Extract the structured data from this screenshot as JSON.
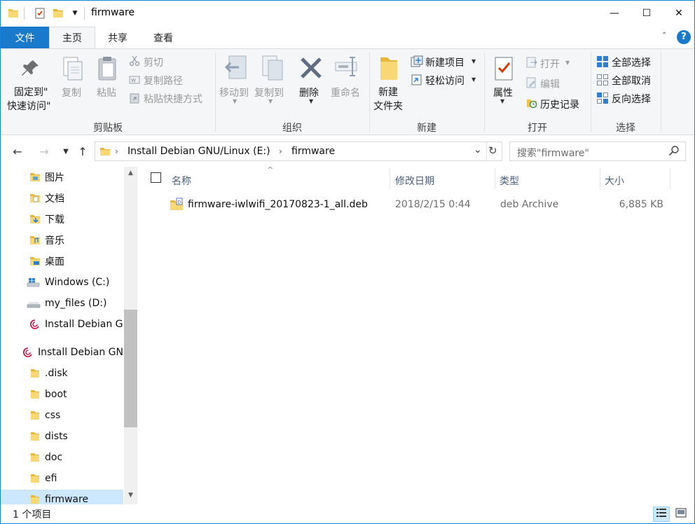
{
  "window": {
    "title": "firmware"
  },
  "title_buttons": {
    "minimize": "—",
    "maximize": "☐",
    "close": "✕"
  },
  "tabs": [
    {
      "label": "文件"
    },
    {
      "label": "主页"
    },
    {
      "label": "共享"
    },
    {
      "label": "查看"
    }
  ],
  "ribbon": {
    "clipboard": {
      "pin_line1": "固定到\"",
      "pin_line2": "快速访问\"",
      "copy": "复制",
      "paste": "粘贴",
      "cut": "剪切",
      "copy_path": "复制路径",
      "paste_shortcut": "粘贴快捷方式",
      "group": "剪贴板"
    },
    "organize": {
      "move_to": "移动到",
      "copy_to": "复制到",
      "delete": "删除",
      "rename": "重命名",
      "group": "组织"
    },
    "new": {
      "new_folder_line1": "新建",
      "new_folder_line2": "文件夹",
      "new_item": "新建项目",
      "easy_access": "轻松访问",
      "group": "新建"
    },
    "open": {
      "properties": "属性",
      "open": "打开",
      "edit": "编辑",
      "history": "历史记录",
      "group": "打开"
    },
    "select": {
      "select_all": "全部选择",
      "select_none": "全部取消",
      "invert": "反向选择",
      "group": "选择"
    }
  },
  "address": {
    "crumbs": [
      "Install Debian GNU/Linux (E:)",
      "firmware"
    ],
    "search_placeholder": "搜索\"firmware\""
  },
  "navpane": {
    "items": [
      {
        "label": "图片",
        "icon": "pictures-folder-icon"
      },
      {
        "label": "文档",
        "icon": "documents-folder-icon"
      },
      {
        "label": "下载",
        "icon": "downloads-folder-icon"
      },
      {
        "label": "音乐",
        "icon": "music-folder-icon"
      },
      {
        "label": "桌面",
        "icon": "desktop-folder-icon"
      },
      {
        "label": "Windows (C:)",
        "icon": "windows-drive-icon"
      },
      {
        "label": "my_files (D:)",
        "icon": "drive-icon"
      },
      {
        "label": "Install Debian GNU/Linux (E:)",
        "icon": "debian-icon"
      },
      {
        "label": "Install Debian GNU/Linux (E:)",
        "icon": "debian-icon"
      },
      {
        "label": ".disk",
        "icon": "folder-icon"
      },
      {
        "label": "boot",
        "icon": "folder-icon"
      },
      {
        "label": "css",
        "icon": "folder-icon"
      },
      {
        "label": "dists",
        "icon": "folder-icon"
      },
      {
        "label": "doc",
        "icon": "folder-icon"
      },
      {
        "label": "efi",
        "icon": "folder-icon"
      },
      {
        "label": "firmware",
        "icon": "folder-icon"
      }
    ]
  },
  "columns": {
    "name": "名称",
    "modified": "修改日期",
    "type": "类型",
    "size": "大小"
  },
  "files": [
    {
      "name": "firmware-iwlwifi_20170823-1_all.deb",
      "modified": "2018/2/15 0:44",
      "type": "deb Archive",
      "size": "6,885 KB"
    }
  ],
  "status": {
    "item_count": "1 个项目"
  },
  "colors": {
    "accent": "#1979ca",
    "folder": "#f8d775",
    "selection": "#cce8ff"
  }
}
